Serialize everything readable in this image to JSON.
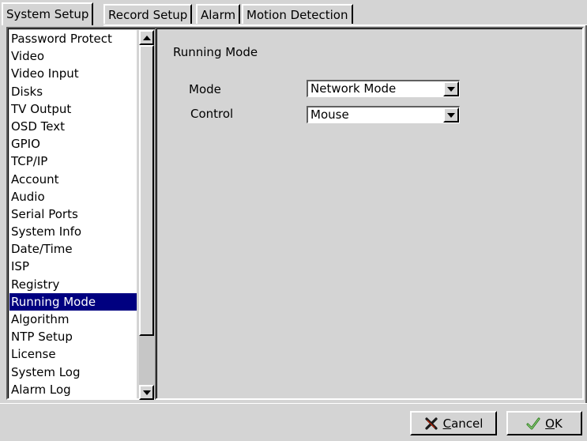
{
  "tabs": [
    {
      "label": "System Setup",
      "active": true
    },
    {
      "label": "Record Setup",
      "active": false
    },
    {
      "label": "Alarm",
      "active": false
    },
    {
      "label": "Motion Detection",
      "active": false
    }
  ],
  "sidebar": {
    "items": [
      {
        "label": "Password Protect"
      },
      {
        "label": "Video"
      },
      {
        "label": "Video Input"
      },
      {
        "label": "Disks"
      },
      {
        "label": "TV Output"
      },
      {
        "label": "OSD Text"
      },
      {
        "label": "GPIO"
      },
      {
        "label": "TCP/IP"
      },
      {
        "label": "Account"
      },
      {
        "label": "Audio"
      },
      {
        "label": "Serial Ports"
      },
      {
        "label": "System Info"
      },
      {
        "label": "Date/Time"
      },
      {
        "label": "ISP"
      },
      {
        "label": "Registry"
      },
      {
        "label": "Running Mode",
        "selected": true
      },
      {
        "label": "Algorithm"
      },
      {
        "label": "NTP Setup"
      },
      {
        "label": "License"
      },
      {
        "label": "System Log"
      },
      {
        "label": "Alarm Log"
      }
    ]
  },
  "main": {
    "section_title": "Running Mode",
    "mode": {
      "label": "Mode",
      "value": "Network Mode"
    },
    "control": {
      "label": "Control",
      "value": "Mouse"
    }
  },
  "buttons": {
    "cancel": {
      "label_prefix": "",
      "label_underline": "C",
      "label_rest": "ancel",
      "icon": "x-icon",
      "icon_color": "#1a1a1a"
    },
    "ok": {
      "label_prefix": "",
      "label_underline": "O",
      "label_rest": "K",
      "icon": "check-icon",
      "icon_color": "#2e7d1e"
    }
  },
  "colors": {
    "selection": "#000080",
    "background": "#d4d4d4"
  }
}
